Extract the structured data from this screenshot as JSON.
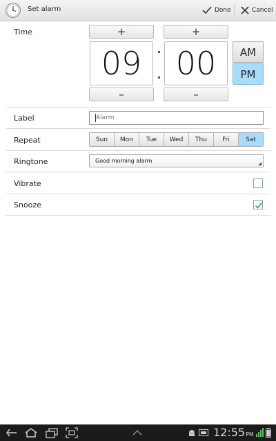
{
  "actionbar": {
    "title": "Set alarm",
    "done_label": "Done",
    "cancel_label": "Cancel",
    "icon": "clock-icon"
  },
  "time": {
    "label": "Time",
    "hour": "09",
    "minute": "00",
    "increment_symbol": "+",
    "decrement_symbol": "–",
    "am_label": "AM",
    "pm_label": "PM",
    "selected_period": "PM"
  },
  "alarm_label": {
    "label": "Label",
    "placeholder": "Alarm",
    "value": ""
  },
  "repeat": {
    "label": "Repeat",
    "days": [
      {
        "name": "Sun",
        "selected": false
      },
      {
        "name": "Mon",
        "selected": false
      },
      {
        "name": "Tue",
        "selected": false
      },
      {
        "name": "Wed",
        "selected": false
      },
      {
        "name": "Thu",
        "selected": false
      },
      {
        "name": "Fri",
        "selected": false
      },
      {
        "name": "Sat",
        "selected": true
      }
    ]
  },
  "ringtone": {
    "label": "Ringtone",
    "value": "Good morning alarm"
  },
  "vibrate": {
    "label": "Vibrate",
    "checked": false
  },
  "snooze": {
    "label": "Snooze",
    "checked": true
  },
  "statusbar": {
    "time": "12:55",
    "meridiem": "PM"
  },
  "colors": {
    "accent": "#a9dcfa",
    "check": "#3fae3f"
  }
}
